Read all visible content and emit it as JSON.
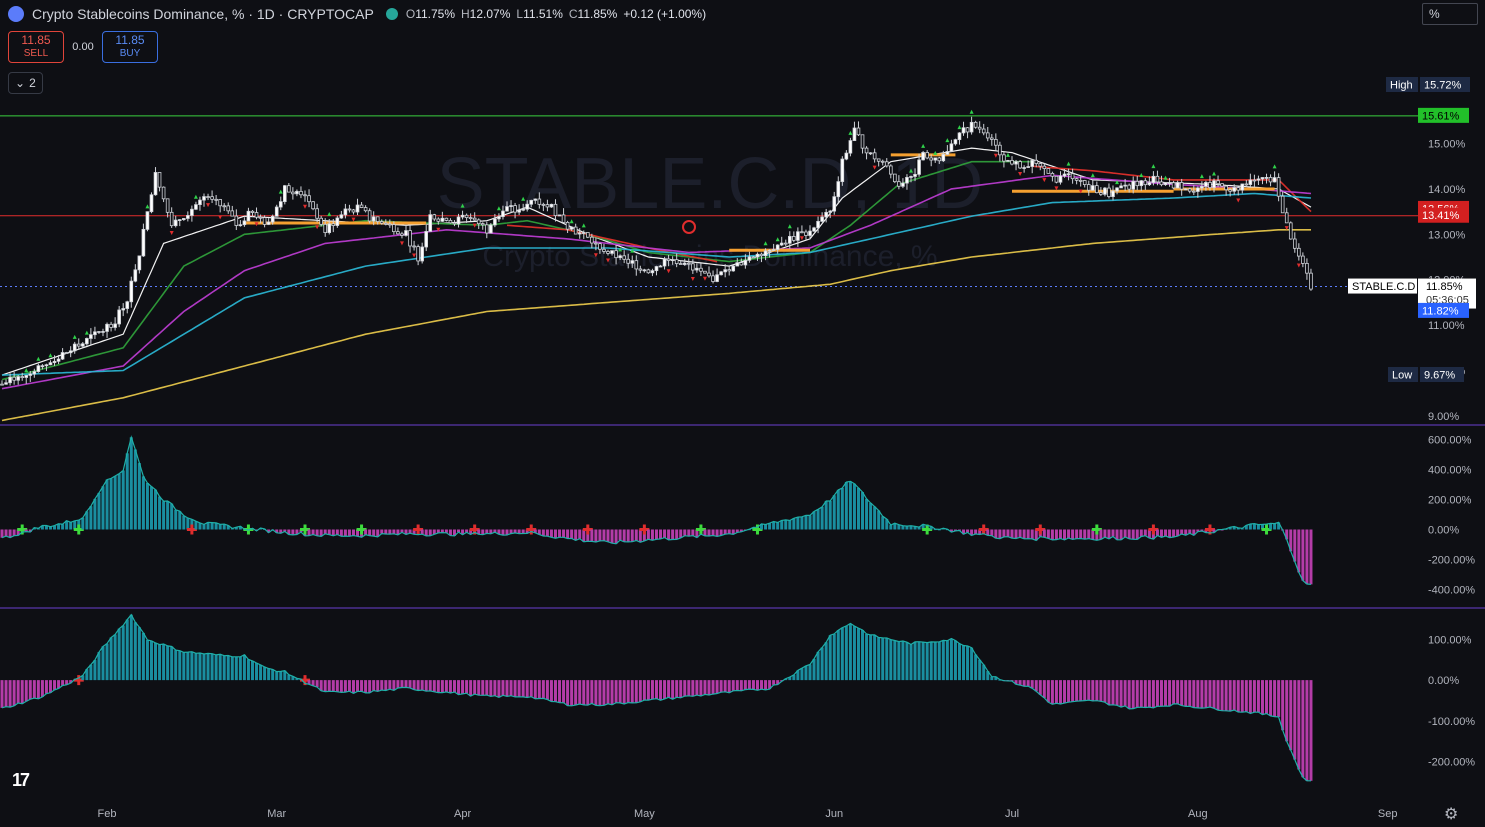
{
  "header": {
    "title": "Crypto Stablecoins Dominance, % · 1D · CRYPTOCAP",
    "ohlc": [
      {
        "k": "O",
        "v": "11.75%"
      },
      {
        "k": "H",
        "v": "12.07%"
      },
      {
        "k": "L",
        "v": "11.51%"
      },
      {
        "k": "C",
        "v": "11.85%"
      },
      {
        "k": "",
        "v": "+0.12 (+1.00%)"
      }
    ]
  },
  "trade": {
    "sell_price": "11.85",
    "sell_label": "SELL",
    "spread": "0.00",
    "buy_price": "11.85",
    "buy_label": "BUY"
  },
  "collapse_count": "2",
  "unit_selector": "%",
  "watermark": {
    "symbol": "STABLE.C.D, 1D",
    "name": "Crypto Stablecoins Dominance, %"
  },
  "price_labels": {
    "high_label": "High",
    "high_value": "15.72%",
    "green_line": "15.61%",
    "red_upper": "13.56%",
    "red_lower": "13.41%",
    "symbol_tag": "STABLE.C.D",
    "last": "11.85%",
    "countdown": "05:36:05",
    "blue": "11.82%",
    "low_label": "Low",
    "low_value": "9.67%"
  },
  "colors": {
    "bg": "#0e0f14",
    "green_level": "#3ad13f",
    "red_level": "#e02d2d",
    "teal": "#1a8ea0",
    "magenta": "#b43ca8",
    "ma_yellow": "#e6c64a",
    "ma_cyan": "#2ab3d0",
    "ma_violet": "#b93ccf",
    "ma_white": "#ffffff",
    "blue_tag": "#2962ff"
  },
  "chart_data": [
    {
      "type": "candlestick",
      "title": "Crypto Stablecoins Dominance, %",
      "ylim": [
        8.8,
        16.4
      ],
      "y_ticks": [
        "15.00%",
        "14.00%",
        "13.00%",
        "12.00%",
        "11.00%",
        "10.00%",
        "9.00%"
      ],
      "x_ticks": [
        "Feb",
        "Mar",
        "Apr",
        "May",
        "Jun",
        "Jul",
        "Aug",
        "Sep"
      ],
      "close_path": [
        [
          0,
          9.7
        ],
        [
          12,
          10.2
        ],
        [
          20,
          10.6
        ],
        [
          28,
          11.1
        ],
        [
          31,
          11.6
        ],
        [
          34,
          12.6
        ],
        [
          38,
          14.4
        ],
        [
          42,
          13.2
        ],
        [
          50,
          13.8
        ],
        [
          55,
          13.6
        ],
        [
          58,
          13.2
        ],
        [
          62,
          13.5
        ],
        [
          66,
          13.2
        ],
        [
          70,
          14.0
        ],
        [
          75,
          13.9
        ],
        [
          80,
          13.1
        ],
        [
          85,
          13.5
        ],
        [
          88,
          13.6
        ],
        [
          92,
          13.3
        ],
        [
          96,
          13.2
        ],
        [
          100,
          13.0
        ],
        [
          103,
          12.5
        ],
        [
          106,
          13.4
        ],
        [
          112,
          13.3
        ],
        [
          116,
          13.4
        ],
        [
          120,
          13.1
        ],
        [
          124,
          13.6
        ],
        [
          128,
          13.5
        ],
        [
          132,
          13.8
        ],
        [
          136,
          13.6
        ],
        [
          140,
          13.2
        ],
        [
          145,
          12.9
        ],
        [
          150,
          12.6
        ],
        [
          155,
          12.4
        ],
        [
          160,
          12.2
        ],
        [
          165,
          12.5
        ],
        [
          170,
          12.3
        ],
        [
          175,
          12.0
        ],
        [
          180,
          12.2
        ],
        [
          185,
          12.5
        ],
        [
          190,
          12.7
        ],
        [
          195,
          12.9
        ],
        [
          200,
          13.1
        ],
        [
          205,
          13.5
        ],
        [
          208,
          14.6
        ],
        [
          211,
          15.3
        ],
        [
          214,
          14.8
        ],
        [
          218,
          14.6
        ],
        [
          222,
          14.1
        ],
        [
          225,
          14.2
        ],
        [
          228,
          14.8
        ],
        [
          231,
          14.6
        ],
        [
          234,
          14.8
        ],
        [
          237,
          15.2
        ],
        [
          240,
          15.4
        ],
        [
          243,
          15.3
        ],
        [
          246,
          14.9
        ],
        [
          250,
          14.5
        ],
        [
          255,
          14.6
        ],
        [
          260,
          14.2
        ],
        [
          265,
          14.3
        ],
        [
          270,
          14.0
        ],
        [
          275,
          13.9
        ],
        [
          280,
          14.1
        ],
        [
          285,
          14.2
        ],
        [
          290,
          14.1
        ],
        [
          295,
          14.0
        ],
        [
          300,
          14.1
        ],
        [
          305,
          14.0
        ],
        [
          310,
          14.2
        ],
        [
          315,
          14.2
        ],
        [
          318,
          13.2
        ],
        [
          321,
          12.5
        ],
        [
          324,
          11.85
        ]
      ],
      "moving_averages": [
        {
          "color": "white",
          "path": [
            [
              0,
              9.9
            ],
            [
              30,
              10.8
            ],
            [
              40,
              12.8
            ],
            [
              60,
              13.4
            ],
            [
              80,
              13.3
            ],
            [
              100,
              13.2
            ],
            [
              120,
              13.3
            ],
            [
              130,
              13.6
            ],
            [
              145,
              13.0
            ],
            [
              160,
              12.5
            ],
            [
              180,
              12.3
            ],
            [
              200,
              12.9
            ],
            [
              208,
              13.8
            ],
            [
              220,
              14.6
            ],
            [
              240,
              14.9
            ],
            [
              250,
              14.8
            ],
            [
              270,
              14.2
            ],
            [
              300,
              14.1
            ],
            [
              316,
              14.0
            ],
            [
              324,
              13.6
            ]
          ]
        },
        {
          "color": "green",
          "path": [
            [
              0,
              9.8
            ],
            [
              30,
              10.5
            ],
            [
              45,
              12.3
            ],
            [
              60,
              13.0
            ],
            [
              90,
              13.3
            ],
            [
              120,
              13.2
            ],
            [
              130,
              13.3
            ],
            [
              145,
              13.0
            ],
            [
              160,
              12.6
            ],
            [
              180,
              12.4
            ],
            [
              200,
              12.6
            ],
            [
              210,
              13.2
            ],
            [
              222,
              14.1
            ],
            [
              240,
              14.6
            ],
            [
              255,
              14.6
            ]
          ]
        },
        {
          "color": "red",
          "path": [
            [
              255,
              14.5
            ],
            [
              270,
              14.4
            ],
            [
              290,
              14.2
            ],
            [
              316,
              14.2
            ],
            [
              324,
              13.5
            ]
          ]
        },
        {
          "color": "red",
          "path": [
            [
              125,
              13.2
            ],
            [
              140,
              13.1
            ],
            [
              160,
              12.7
            ],
            [
              177,
              12.4
            ]
          ]
        },
        {
          "color": "violet",
          "path": [
            [
              0,
              9.6
            ],
            [
              30,
              10.1
            ],
            [
              45,
              11.3
            ],
            [
              60,
              12.2
            ],
            [
              80,
              12.8
            ],
            [
              110,
              13.1
            ],
            [
              140,
              12.9
            ],
            [
              170,
              12.6
            ],
            [
              200,
              12.7
            ],
            [
              215,
              13.2
            ],
            [
              235,
              14.0
            ],
            [
              260,
              14.3
            ],
            [
              290,
              14.1
            ],
            [
              310,
              14.0
            ],
            [
              324,
              13.9
            ]
          ]
        },
        {
          "color": "cyan",
          "path": [
            [
              0,
              9.9
            ],
            [
              30,
              10.0
            ],
            [
              45,
              10.8
            ],
            [
              60,
              11.6
            ],
            [
              90,
              12.3
            ],
            [
              120,
              12.7
            ],
            [
              150,
              12.7
            ],
            [
              180,
              12.5
            ],
            [
              200,
              12.6
            ],
            [
              220,
              13.0
            ],
            [
              240,
              13.4
            ],
            [
              260,
              13.7
            ],
            [
              290,
              13.8
            ],
            [
              310,
              13.9
            ],
            [
              324,
              13.8
            ]
          ]
        },
        {
          "color": "yellow",
          "path": [
            [
              0,
              8.9
            ],
            [
              30,
              9.4
            ],
            [
              60,
              10.1
            ],
            [
              90,
              10.8
            ],
            [
              120,
              11.3
            ],
            [
              150,
              11.5
            ],
            [
              180,
              11.7
            ],
            [
              205,
              11.9
            ],
            [
              220,
              12.2
            ],
            [
              240,
              12.5
            ],
            [
              270,
              12.8
            ],
            [
              300,
              13.0
            ],
            [
              316,
              13.1
            ],
            [
              324,
              13.1
            ]
          ]
        }
      ],
      "levels": {
        "green": 15.61,
        "red_upper": 13.56,
        "red_lower": 13.41,
        "last": 11.85
      }
    },
    {
      "type": "bar",
      "ylim": [
        -470,
        650
      ],
      "y_ticks": [
        "600.00%",
        "400.00%",
        "200.00%",
        "0.00%",
        "-200.00%",
        "-400.00%"
      ],
      "values_path": [
        [
          0,
          -60
        ],
        [
          10,
          20
        ],
        [
          15,
          40
        ],
        [
          20,
          80
        ],
        [
          25,
          300
        ],
        [
          30,
          400
        ],
        [
          32,
          620
        ],
        [
          35,
          350
        ],
        [
          40,
          200
        ],
        [
          45,
          100
        ],
        [
          50,
          40
        ],
        [
          60,
          10
        ],
        [
          70,
          -20
        ],
        [
          80,
          -40
        ],
        [
          90,
          -40
        ],
        [
          100,
          -30
        ],
        [
          110,
          -30
        ],
        [
          120,
          -30
        ],
        [
          130,
          -20
        ],
        [
          140,
          -60
        ],
        [
          150,
          -90
        ],
        [
          160,
          -70
        ],
        [
          170,
          -50
        ],
        [
          180,
          -30
        ],
        [
          190,
          40
        ],
        [
          200,
          100
        ],
        [
          205,
          200
        ],
        [
          210,
          330
        ],
        [
          215,
          180
        ],
        [
          220,
          40
        ],
        [
          230,
          20
        ],
        [
          240,
          -30
        ],
        [
          250,
          -60
        ],
        [
          270,
          -60
        ],
        [
          290,
          -50
        ],
        [
          310,
          30
        ],
        [
          316,
          40
        ],
        [
          318,
          -60
        ],
        [
          322,
          -350
        ],
        [
          324,
          -370
        ]
      ]
    },
    {
      "type": "bar",
      "ylim": [
        -270,
        160
      ],
      "y_ticks": [
        "100.00%",
        "0.00%",
        "-100.00%",
        "-200.00%"
      ],
      "values_path": [
        [
          0,
          -70
        ],
        [
          10,
          -40
        ],
        [
          20,
          10
        ],
        [
          25,
          80
        ],
        [
          32,
          160
        ],
        [
          36,
          100
        ],
        [
          45,
          70
        ],
        [
          55,
          60
        ],
        [
          60,
          60
        ],
        [
          65,
          30
        ],
        [
          70,
          20
        ],
        [
          80,
          -30
        ],
        [
          90,
          -30
        ],
        [
          100,
          -20
        ],
        [
          110,
          -30
        ],
        [
          120,
          -40
        ],
        [
          130,
          -40
        ],
        [
          140,
          -60
        ],
        [
          150,
          -60
        ],
        [
          160,
          -50
        ],
        [
          170,
          -40
        ],
        [
          180,
          -30
        ],
        [
          190,
          -20
        ],
        [
          200,
          40
        ],
        [
          205,
          110
        ],
        [
          210,
          140
        ],
        [
          215,
          110
        ],
        [
          225,
          90
        ],
        [
          235,
          100
        ],
        [
          240,
          80
        ],
        [
          245,
          10
        ],
        [
          255,
          -20
        ],
        [
          260,
          -60
        ],
        [
          270,
          -50
        ],
        [
          280,
          -70
        ],
        [
          290,
          -60
        ],
        [
          300,
          -70
        ],
        [
          310,
          -80
        ],
        [
          316,
          -90
        ],
        [
          318,
          -150
        ],
        [
          322,
          -240
        ],
        [
          324,
          -250
        ]
      ]
    }
  ]
}
